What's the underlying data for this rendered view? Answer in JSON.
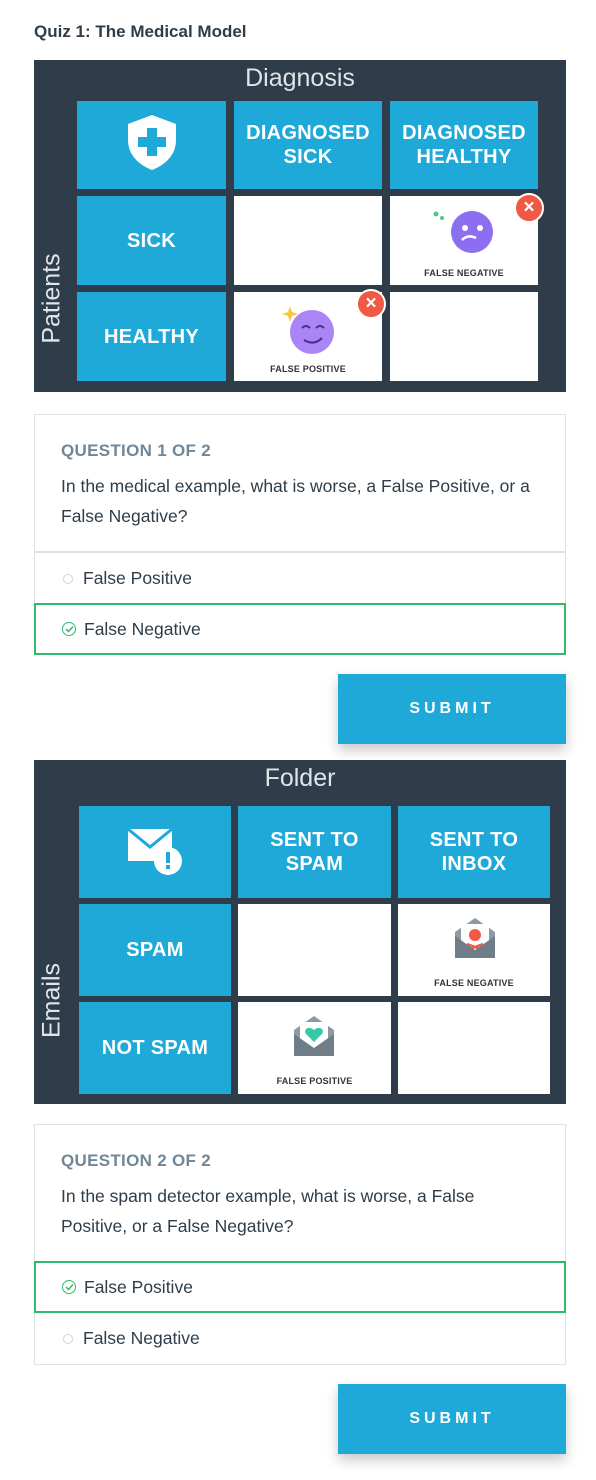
{
  "page_title": "Quiz 1: The Medical Model",
  "figure1": {
    "title": "Diagnosis",
    "side_label": "Patients",
    "header_icon": "medical-shield-icon",
    "col_headers": [
      "DIAGNOSED\nSICK",
      "DIAGNOSED\nHEALTHY"
    ],
    "row_headers": [
      "SICK",
      "HEALTHY"
    ],
    "false_negative_label": "FALSE NEGATIVE",
    "false_positive_label": "FALSE POSITIVE",
    "colors": {
      "background": "#2e3d49",
      "cell_blue": "#1ea9d8",
      "emoji": "#8b6ff0",
      "x_badge": "#f05a45"
    }
  },
  "question1": {
    "count": "QUESTION 1 OF 2",
    "text": "In the medical example, what is worse, a False Positive, or a False Negative?",
    "options": [
      {
        "label": "False Positive",
        "selected": false
      },
      {
        "label": "False Negative",
        "selected": true
      }
    ],
    "submit_label": "SUBMIT"
  },
  "figure2": {
    "title": "Folder",
    "side_label": "Emails",
    "header_icon": "mail-warning-icon",
    "col_headers": [
      "SENT TO\nSPAM",
      "SENT TO\nINBOX"
    ],
    "row_headers": [
      "SPAM",
      "NOT SPAM"
    ],
    "false_negative_label": "FALSE NEGATIVE",
    "false_positive_label": "FALSE POSITIVE"
  },
  "question2": {
    "count": "QUESTION 2 OF 2",
    "text": "In the spam detector example, what is worse, a False Positive, or a False Negative?",
    "options": [
      {
        "label": "False Positive",
        "selected": true
      },
      {
        "label": "False Negative",
        "selected": false
      }
    ],
    "submit_label": "SUBMIT"
  },
  "colors": {
    "accent": "#1ea9d8",
    "selected_border": "#2ebc6a",
    "dark": "#2e3d49"
  }
}
